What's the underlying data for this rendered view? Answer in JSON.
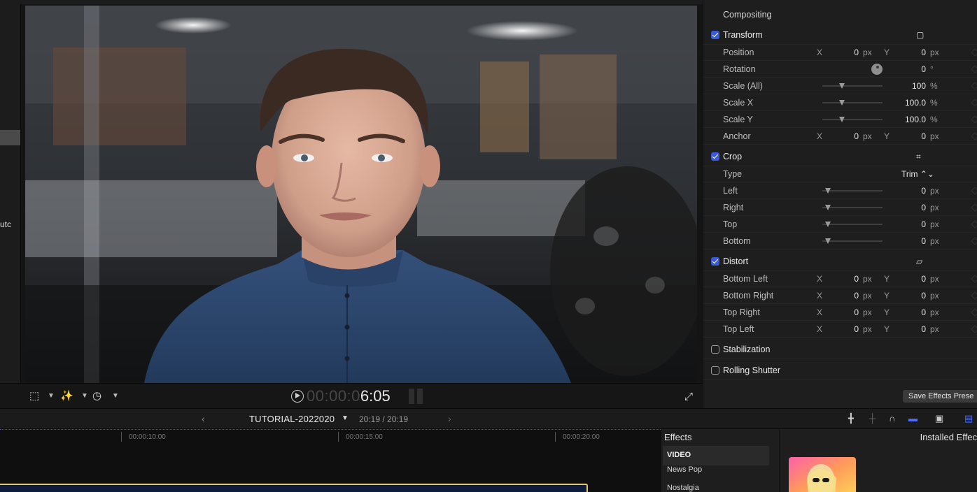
{
  "sidebar": {
    "cut_text": "utc"
  },
  "viewer": {
    "timecode_dim": "00:00:0",
    "timecode_bright": "6:05",
    "toolbar_icons": [
      "transform-crop-tool-icon",
      "enhance-wand-icon",
      "retime-speed-icon",
      "fullscreen-icon"
    ]
  },
  "inspector": {
    "title": "Compositing",
    "sections": {
      "transform": {
        "label": "Transform",
        "checked": true,
        "rows": {
          "position": {
            "label": "Position",
            "x_label": "X",
            "x": "0",
            "x_unit": "px",
            "y_label": "Y",
            "y": "0",
            "y_unit": "px"
          },
          "rotation": {
            "label": "Rotation",
            "value": "0",
            "unit": "°"
          },
          "scale_all": {
            "label": "Scale (All)",
            "value": "100",
            "unit": "%"
          },
          "scale_x": {
            "label": "Scale X",
            "value": "100.0",
            "unit": "%"
          },
          "scale_y": {
            "label": "Scale Y",
            "value": "100.0",
            "unit": "%"
          },
          "anchor": {
            "label": "Anchor",
            "x_label": "X",
            "x": "0",
            "x_unit": "px",
            "y_label": "Y",
            "y": "0",
            "y_unit": "px"
          }
        }
      },
      "crop": {
        "label": "Crop",
        "checked": true,
        "type": {
          "label": "Type",
          "value": "Trim ⌃⌄"
        },
        "rows": {
          "left": {
            "label": "Left",
            "value": "0",
            "unit": "px"
          },
          "right": {
            "label": "Right",
            "value": "0",
            "unit": "px"
          },
          "top": {
            "label": "Top",
            "value": "0",
            "unit": "px"
          },
          "bottom": {
            "label": "Bottom",
            "value": "0",
            "unit": "px"
          }
        }
      },
      "distort": {
        "label": "Distort",
        "checked": true,
        "rows": {
          "bottom_left": {
            "label": "Bottom Left",
            "x_label": "X",
            "x": "0",
            "x_unit": "px",
            "y_label": "Y",
            "y": "0",
            "y_unit": "px"
          },
          "bottom_right": {
            "label": "Bottom Right",
            "x_label": "X",
            "x": "0",
            "x_unit": "px",
            "y_label": "Y",
            "y": "0",
            "y_unit": "px"
          },
          "top_right": {
            "label": "Top Right",
            "x_label": "X",
            "x": "0",
            "x_unit": "px",
            "y_label": "Y",
            "y": "0",
            "y_unit": "px"
          },
          "top_left": {
            "label": "Top Left",
            "x_label": "X",
            "x": "0",
            "x_unit": "px",
            "y_label": "Y",
            "y": "0",
            "y_unit": "px"
          }
        }
      },
      "stabilization": {
        "label": "Stabilization",
        "checked": false
      },
      "rolling_shutter": {
        "label": "Rolling Shutter",
        "checked": false
      }
    },
    "save_preset_label": "Save Effects Prese"
  },
  "timeline_header": {
    "project_name": "TUTORIAL-2022020",
    "duration": "20:19 / 20:19",
    "right_icons": [
      "skimming-icon",
      "audio-skimming-icon",
      "headphones-icon",
      "snapping-icon",
      "clip-appearance-icon",
      "browser-toggle-icon"
    ]
  },
  "timeline": {
    "ticks": [
      {
        "label": "00:00:10:00"
      },
      {
        "label": "00:00:15:00"
      },
      {
        "label": "00:00:20:00"
      }
    ]
  },
  "effects": {
    "header": "Effects",
    "installed_header": "Installed Effec",
    "category": "VIDEO",
    "items": [
      "News Pop",
      "Nostalgia"
    ]
  },
  "colors": {
    "accent_blue": "#3a5bdc",
    "clip_border": "#e3c66a",
    "panel_bg": "#1e1e1e"
  }
}
